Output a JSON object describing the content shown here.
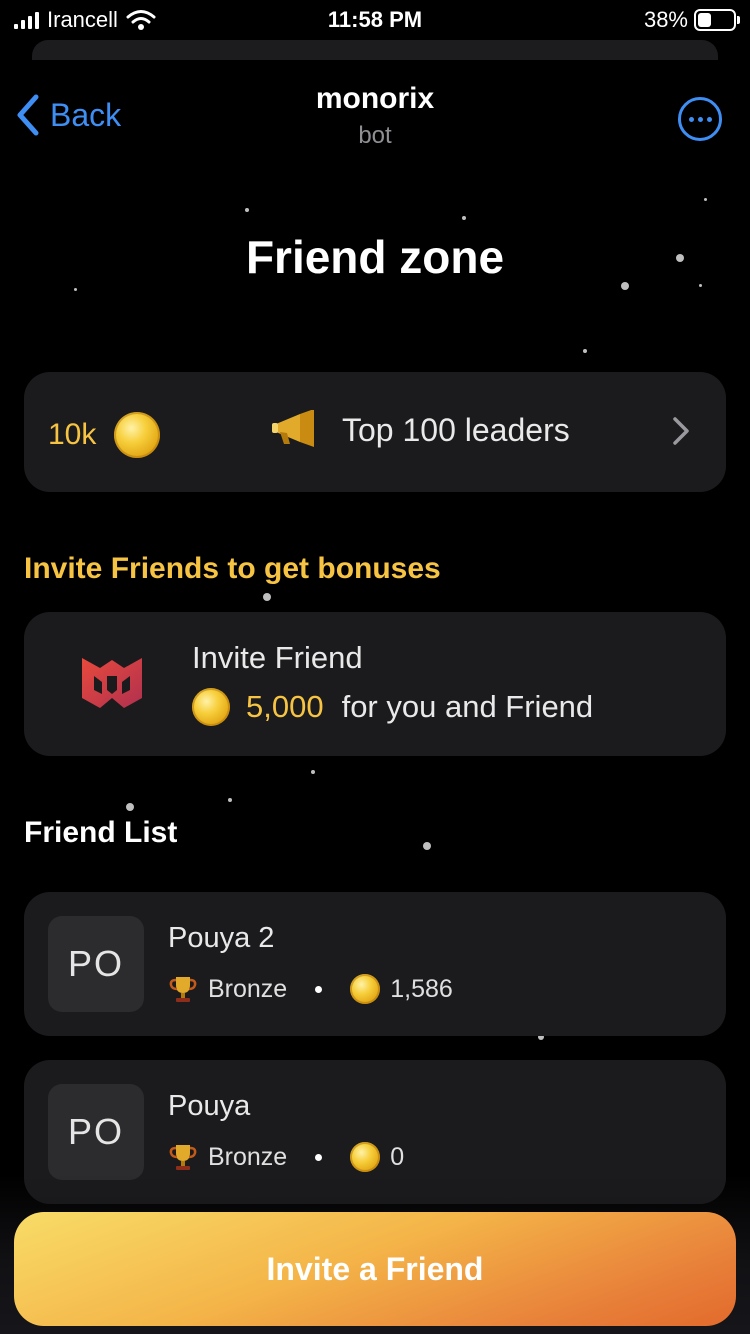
{
  "status_bar": {
    "carrier": "Irancell",
    "time": "11:58 PM",
    "battery_percent": "38%",
    "battery_level": 0.38
  },
  "header": {
    "back_label": "Back",
    "title": "monorix",
    "subtitle": "bot"
  },
  "page": {
    "title": "Friend zone"
  },
  "leaders_card": {
    "points": "10k",
    "label": "Top 100 leaders"
  },
  "invite_section": {
    "heading": "Invite Friends to get bonuses",
    "card_title": "Invite Friend",
    "reward_amount": "5,000",
    "reward_text": "for you and Friend"
  },
  "friend_list": {
    "heading": "Friend List",
    "items": [
      {
        "initials": "PO",
        "name": "Pouya 2",
        "league": "Bronze",
        "coins": "1,586"
      },
      {
        "initials": "PO",
        "name": "Pouya",
        "league": "Bronze",
        "coins": "0"
      }
    ]
  },
  "bottom_button": {
    "label": "Invite a Friend"
  },
  "icons": {
    "back": "chevron-left-icon",
    "more": "more-horizontal-icon",
    "coin": "coin-icon",
    "megaphone": "megaphone-icon",
    "chevron": "chevron-right-icon",
    "trophy": "trophy-icon",
    "logo": "monorix-logo-icon"
  },
  "colors": {
    "accent_blue": "#3f8ef4",
    "gold": "#f6c343",
    "card_bg": "#1b1b1d",
    "button_gradient_start": "#f8dc67",
    "button_gradient_end": "#e26a2c"
  }
}
